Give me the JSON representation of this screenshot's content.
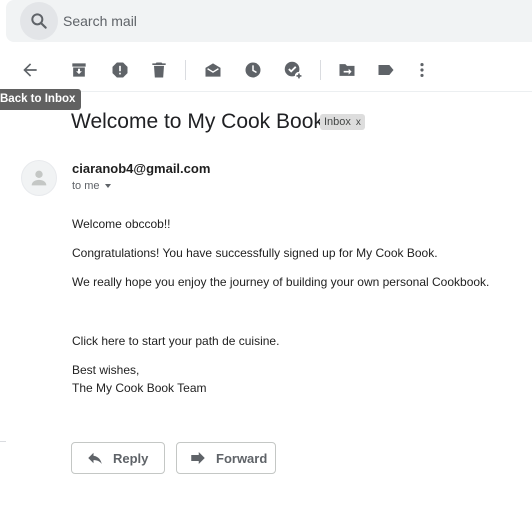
{
  "search": {
    "placeholder": "Search mail",
    "icon": "search-icon"
  },
  "toolbar": {
    "icons": [
      "back-arrow-icon",
      "archive-icon",
      "report-spam-icon",
      "delete-icon",
      "mark-unread-icon",
      "snooze-icon",
      "add-to-tasks-icon",
      "move-to-icon",
      "label-icon",
      "more-vert-icon"
    ],
    "tooltip": "Back to Inbox"
  },
  "message": {
    "subject": "Welcome to My Cook Book",
    "label": "Inbox",
    "label_remove": "x",
    "sender": "ciaranob4@gmail.com",
    "recipient": "to me",
    "body": {
      "greeting_prefix": "Welcome ",
      "greeting_name": "obccob!!",
      "line1": "Congratulations! You have successfully signed up for My Cook Book.",
      "line2": "We really hope you enjoy the journey of building your own personal Cookbook.",
      "line3": "Click here to start your path de cuisine.",
      "signoff1": "Best wishes,",
      "signoff2": "The My Cook Book Team"
    }
  },
  "actions": {
    "reply": "Reply",
    "forward": "Forward"
  },
  "colors": {
    "icon": "#5f6368",
    "search_bg": "#f1f3f4",
    "tooltip_bg": "#616161",
    "chip_bg": "#dddddd"
  }
}
